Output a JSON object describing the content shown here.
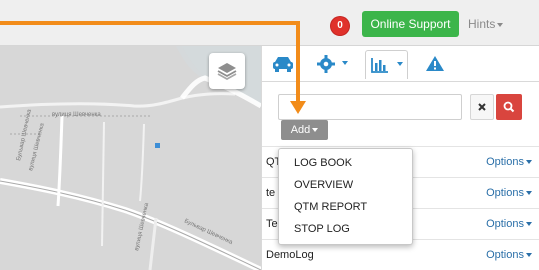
{
  "header": {
    "notification_count": "0",
    "online_support_label": "Online Support",
    "hints_label": "Hints"
  },
  "map": {
    "street_labels": [
      "Бульвар Шевченка",
      "вулиця Шевченка"
    ],
    "layers_button_icon": "layers-icon"
  },
  "toolbar": {
    "tabs": [
      {
        "icon": "car-icon",
        "dropdown": false
      },
      {
        "icon": "gear-icon",
        "dropdown": true
      },
      {
        "icon": "bar-chart-icon",
        "dropdown": true
      },
      {
        "icon": "warning-icon",
        "dropdown": false
      }
    ]
  },
  "search": {
    "value": "",
    "placeholder": "",
    "clear_icon": "close-icon",
    "search_icon": "search-icon"
  },
  "add_button": {
    "label": "Add"
  },
  "list": [
    {
      "name": "QT",
      "options": "Options"
    },
    {
      "name": "te",
      "options": "Options"
    },
    {
      "name": "Te",
      "options": "Options"
    },
    {
      "name": "DemoLog",
      "options": "Options"
    }
  ],
  "add_menu": {
    "items": [
      "LOG BOOK",
      "OVERVIEW",
      "QTM REPORT",
      "STOP LOG"
    ]
  },
  "colors": {
    "accent_arrow": "#f28c1a",
    "badge_red": "#e0312b",
    "support_green": "#3cb54a",
    "search_red": "#d9453e",
    "icon_blue": "#2a89c8",
    "link_blue": "#2a6fa8"
  }
}
